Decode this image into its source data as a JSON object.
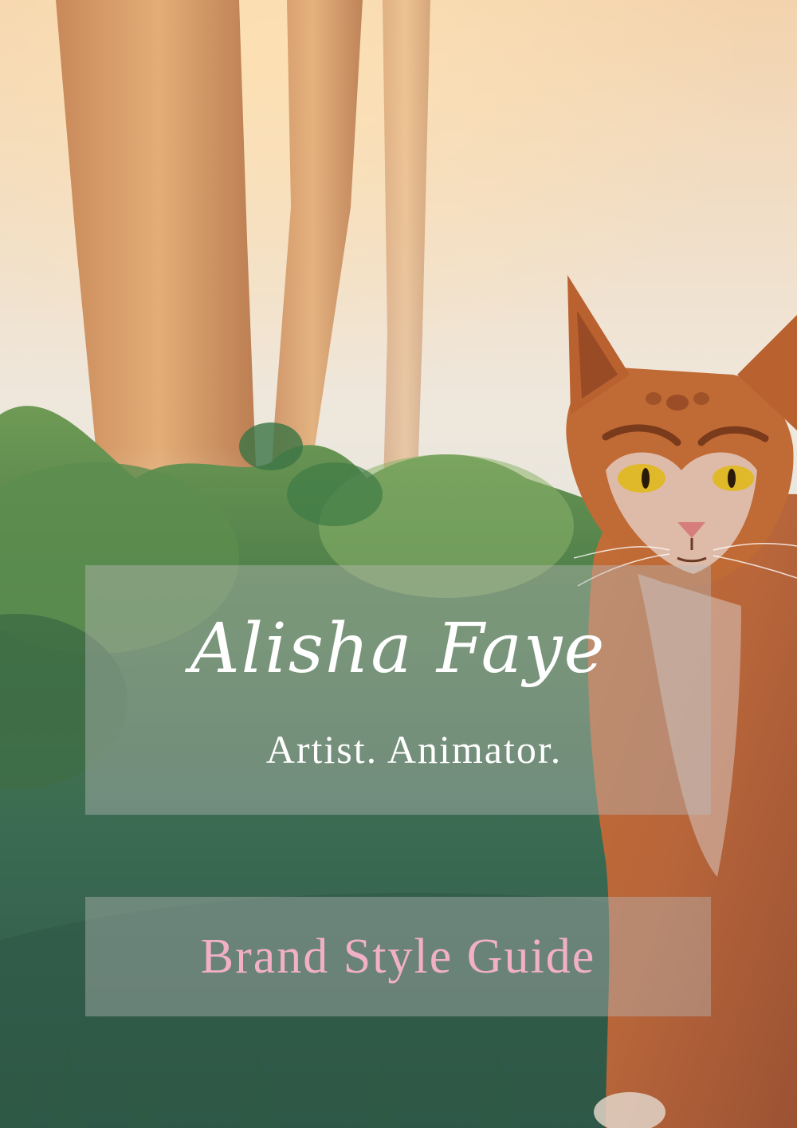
{
  "cover": {
    "name": "Alisha Faye",
    "tagline": "Artist. Animator.",
    "guide_title": "Brand Style Guide"
  },
  "colors": {
    "guide_text": "#f2b0c7",
    "title_text": "#ffffff",
    "panel": "rgba(185,185,185,0.42)"
  },
  "illustration": {
    "subject": "forest-lynx-illustration"
  }
}
